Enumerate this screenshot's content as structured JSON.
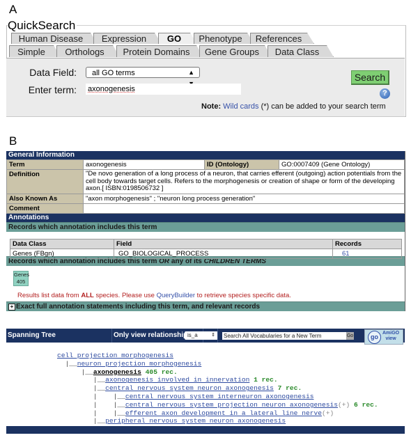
{
  "panels": {
    "a": "A",
    "b": "B"
  },
  "quicksearch": {
    "title": "QuickSearch",
    "tabs_row1": [
      {
        "label": "Human Disease",
        "active": false
      },
      {
        "label": "Expression",
        "active": false
      },
      {
        "label": "GO",
        "active": true
      },
      {
        "label": "Phenotype",
        "active": false
      },
      {
        "label": "References",
        "active": false
      }
    ],
    "tabs_row2": [
      {
        "label": "Simple"
      },
      {
        "label": "Orthologs"
      },
      {
        "label": "Protein Domains"
      },
      {
        "label": "Gene Groups"
      },
      {
        "label": "Data Class"
      }
    ],
    "data_field_label": "Data Field:",
    "data_field_value": "all GO terms",
    "enter_term_label": "Enter term:",
    "term_value": "axonogenesis",
    "search_button": "Search",
    "help_icon": "?",
    "note_bold": "Note:",
    "note_link": "Wild cards",
    "note_rest": " (*) can be added to your search term"
  },
  "term_report": {
    "general_header": "General Information",
    "term_label": "Term",
    "term_value": "axonogenesis",
    "id_label": "ID (Ontology)",
    "id_value": "GO:0007409 (Gene Ontology)",
    "definition_label": "Definition",
    "definition_value": "\"De novo generation of a long process of a neuron, that carries efferent (outgoing) action potentials from the cell body towards target cells. Refers to the morphogenesis or creation of shape or form of the developing axon.[ ISBN:0198506732 ]",
    "aka_label": "Also Known As",
    "aka_value": "\"axon morphogenesis\" ; \"neuron long process generation\"",
    "comment_label": "Comment",
    "comment_value": "",
    "annotations_header": "Annotations",
    "records_header": "Records which annotation includes this term",
    "annotation_table": {
      "headers": [
        "Data Class",
        "Field",
        "Records"
      ],
      "rows": [
        {
          "data_class": "Genes (FBgn)",
          "field": "GO_BIOLOGICAL_PROCESS",
          "records": "61"
        }
      ]
    },
    "children_header_a": "Records which annotation includes this term ",
    "children_header_or": "OR",
    "children_header_b": " any of its ",
    "children_header_c": "CHILDREN TERMS",
    "genes_label": "Genes",
    "genes_count": "405",
    "species_note_a": "Results list data from ",
    "species_note_all": "ALL",
    "species_note_b": " species. Please use ",
    "species_note_link": "QueryBuilder",
    "species_note_c": " to retrieve species specific data.",
    "exact_header": "Exact full annotation statements including this term, and relevant records",
    "expand_icon": "+"
  },
  "spanning_tree": {
    "label": "Spanning Tree (Parents/Children)",
    "relationship_label": "Only view relationship:",
    "relationship_value": "is_a",
    "vocab_search_placeholder": "Search All Vocabularies for a New Term",
    "go_button": "Go",
    "amigo_logo": "go",
    "amigo_line1": "AmiGO",
    "amigo_line2": "view",
    "nodes": [
      {
        "prefix": "",
        "term": "cell projection morphogenesis",
        "current": false,
        "count": "",
        "plus": false
      },
      {
        "prefix": "  |__",
        "term": "neuron projection morphogenesis",
        "current": false,
        "count": "",
        "plus": false
      },
      {
        "prefix": "      |__",
        "term": "axonogenesis",
        "current": true,
        "count": "405 rec.",
        "plus": false
      },
      {
        "prefix": "         |__",
        "term": "axonogenesis involved in innervation",
        "current": false,
        "count": "1 rec.",
        "plus": false
      },
      {
        "prefix": "         |__",
        "term": "central nervous system neuron axonogenesis",
        "current": false,
        "count": "7 rec.",
        "plus": false
      },
      {
        "prefix": "         |    |__",
        "term": "central nervous system interneuron axonogenesis",
        "current": false,
        "count": "",
        "plus": false
      },
      {
        "prefix": "         |    |__",
        "term": "central nervous system projection neuron axonogenesis",
        "current": false,
        "count": "6 rec.",
        "plus": true
      },
      {
        "prefix": "         |    |__",
        "term": "efferent axon development in a lateral line nerve",
        "current": false,
        "count": "",
        "plus": true
      },
      {
        "prefix": "         |__",
        "term": "peripheral nervous system neuron axonogenesis",
        "current": false,
        "count": "",
        "plus": false
      }
    ],
    "plus_marker": "(+)"
  },
  "colors": {
    "header_dark": "#1b3261",
    "header_teal": "#6b9e97",
    "label_bg": "#cbc4aa",
    "search_green": "#7fcf73",
    "link_blue": "#2e4ba0",
    "count_green": "#2a8a2a",
    "warning_red": "#b32020"
  }
}
